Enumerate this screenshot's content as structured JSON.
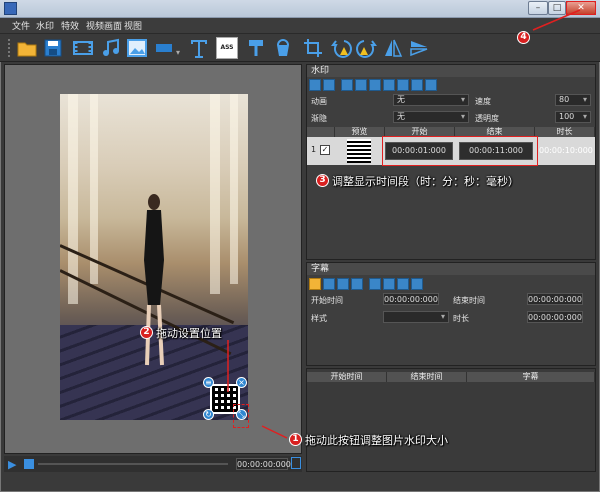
{
  "window": {
    "min": "–",
    "max": "□",
    "close": "✕"
  },
  "menu": [
    "文件",
    "水印",
    "特效",
    "视频画面",
    "视图"
  ],
  "toolbar_icons": [
    "folder-icon",
    "save-icon",
    "film-icon",
    "music-icon",
    "image-icon",
    "shape-icon",
    "text-icon",
    "ass-subtitle-icon",
    "brush-icon",
    "bucket-icon",
    "crop-icon",
    "rotate-left-icon",
    "rotate-right-icon",
    "flip-horizontal-icon",
    "flip-vertical-icon"
  ],
  "toolbar_ass": "ASS",
  "preview": {
    "time": "00:00:00:000"
  },
  "watermark_panel": {
    "title": "水印",
    "animation_label": "动画",
    "animation_value": "无",
    "speed_label": "速度",
    "speed_value": "80",
    "fade_label": "渐隐",
    "fade_value": "无",
    "opacity_label": "透明度",
    "opacity_value": "100",
    "columns": [
      "预览",
      "开始",
      "结束",
      "时长"
    ],
    "row": {
      "index": "1",
      "start": "00:00:01:000",
      "end": "00:00:11:000",
      "duration": "00:00:10:000"
    }
  },
  "subtitle_panel": {
    "title": "字幕",
    "start_label": "开始时间",
    "start_value": "00:00:00:000",
    "end_label": "结束时间",
    "end_value": "00:00:00:000",
    "style_label": "样式",
    "duration_label": "时长",
    "duration_value": "00:00:00:000",
    "columns": [
      "开始时间",
      "结束时间",
      "字幕"
    ]
  },
  "annotations": {
    "a1": {
      "num": "1",
      "text": "拖动此按钮调整图片水印大小"
    },
    "a2": {
      "num": "2",
      "text": "拖动设置位置"
    },
    "a3": {
      "num": "3",
      "text": "调整显示时间段（时：分：秒：毫秒）"
    },
    "a4": {
      "num": "4"
    }
  },
  "colors": {
    "accent": "#d82020",
    "handle": "#2f86d1",
    "panel": "#3e3e3e"
  }
}
